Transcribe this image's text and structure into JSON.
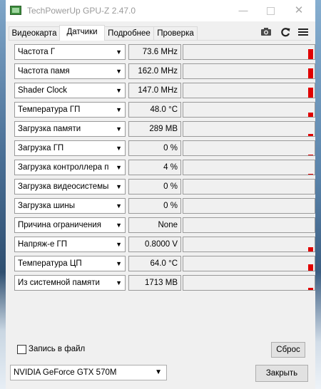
{
  "window": {
    "title": "TechPowerUp GPU-Z 2.47.0",
    "minimize_glyph": "—",
    "close_glyph": "✕"
  },
  "tabs": [
    {
      "label": "Видеокарта",
      "active": false
    },
    {
      "label": "Датчики",
      "active": true
    },
    {
      "label": "Подробнее",
      "active": false
    },
    {
      "label": "Проверка",
      "active": false
    }
  ],
  "toolbar": {
    "icons": [
      "camera-icon",
      "refresh-icon",
      "menu-icon"
    ]
  },
  "dropdown_glyph": "▼",
  "sensors": [
    {
      "name": "Частота Г",
      "value": "73.6 MHz",
      "level": 0.7
    },
    {
      "name": "Частота памя",
      "value": "162.0 MHz",
      "level": 0.7
    },
    {
      "name": "Shader Clock",
      "value": "147.0 MHz",
      "level": 0.7
    },
    {
      "name": "Температура ГП",
      "value": "48.0 °C",
      "level": 0.3
    },
    {
      "name": "Загрузка памяти",
      "value": "289 MB",
      "level": 0.15
    },
    {
      "name": "Загрузка ГП",
      "value": "0 %",
      "level": 0.05
    },
    {
      "name": "Загрузка контроллера пам.",
      "value": "4 %",
      "level": 0.05
    },
    {
      "name": "Загрузка видеосистемы",
      "value": "0 %",
      "level": 0.0
    },
    {
      "name": "Загрузка шины",
      "value": "0 %",
      "level": 0.0
    },
    {
      "name": "Причина ограничения",
      "value": "None",
      "level": 0.0
    },
    {
      "name": "Напряж-е ГП",
      "value": "0.8000 V",
      "level": 0.3
    },
    {
      "name": "Температура ЦП",
      "value": "64.0 °C",
      "level": 0.45
    },
    {
      "name": "Из системной памяти",
      "value": "1713 MB",
      "level": 0.15
    }
  ],
  "log_to_file": {
    "label": "Запись в файл",
    "checked": false
  },
  "reset_label": "Сброс",
  "gpu_select": {
    "value": "NVIDIA GeForce GTX 570M"
  },
  "close_label": "Закрыть",
  "colors": {
    "graph_bar": "#e00000",
    "window_bg": "#f0f0f0"
  }
}
